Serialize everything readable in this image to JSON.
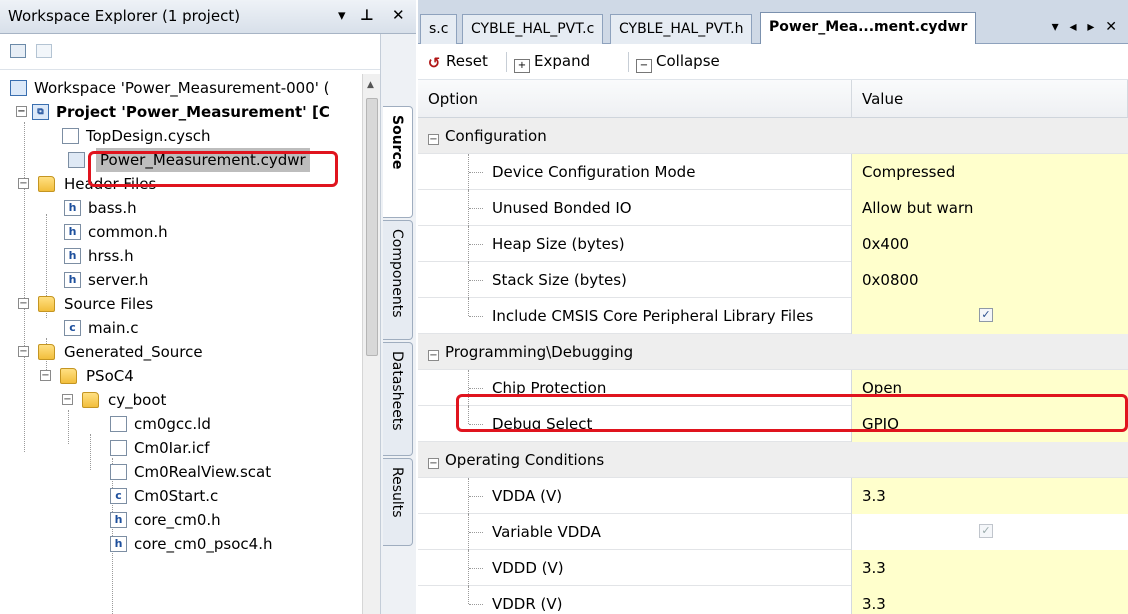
{
  "explorer": {
    "title": "Workspace Explorer (1 project)",
    "controls": "▾ ⊥ ✕",
    "tree": {
      "workspace": "Workspace 'Power_Measurement-000' (",
      "project": "Project  'Power_Measurement' [C",
      "items": [
        {
          "label": "TopDesign.cysch"
        },
        {
          "label": "Power_Measurement.cydwr"
        },
        {
          "label": "Header Files"
        },
        {
          "label": "bass.h"
        },
        {
          "label": "common.h"
        },
        {
          "label": "hrss.h"
        },
        {
          "label": "server.h"
        },
        {
          "label": "Source Files"
        },
        {
          "label": "main.c"
        },
        {
          "label": "Generated_Source"
        },
        {
          "label": "PSoC4"
        },
        {
          "label": "cy_boot"
        },
        {
          "label": "cm0gcc.ld"
        },
        {
          "label": "Cm0Iar.icf"
        },
        {
          "label": "Cm0RealView.scat"
        },
        {
          "label": "Cm0Start.c"
        },
        {
          "label": "core_cm0.h"
        },
        {
          "label": "core_cm0_psoc4.h"
        }
      ]
    },
    "side_tabs": [
      "Source",
      "Components",
      "Datasheets",
      "Results"
    ]
  },
  "editor": {
    "tabs": [
      "s.c",
      "CYBLE_HAL_PVT.c",
      "CYBLE_HAL_PVT.h",
      "Power_Mea...ment.cydwr"
    ],
    "tab_controls": "▾ ◂ ▸ ✕",
    "commands": {
      "reset": "Reset",
      "expand": "Expand",
      "collapse": "Collapse"
    },
    "grid": {
      "headers": [
        "Option",
        "Value"
      ],
      "rows": [
        {
          "type": "cat",
          "label": "Configuration"
        },
        {
          "type": "opt",
          "label": "Device Configuration Mode",
          "value": "Compressed"
        },
        {
          "type": "opt",
          "label": "Unused Bonded IO",
          "value": "Allow but warn"
        },
        {
          "type": "opt",
          "label": "Heap Size (bytes)",
          "value": "0x400"
        },
        {
          "type": "opt",
          "label": "Stack Size (bytes)",
          "value": "0x0800"
        },
        {
          "type": "chk",
          "label": "Include CMSIS Core Peripheral Library Files",
          "checked": true
        },
        {
          "type": "cat",
          "label": "Programming\\Debugging"
        },
        {
          "type": "opt",
          "label": "Chip Protection",
          "value": "Open"
        },
        {
          "type": "opt",
          "label": "Debug Select",
          "value": "GPIO"
        },
        {
          "type": "cat",
          "label": "Operating Conditions"
        },
        {
          "type": "opt",
          "label": "VDDA (V)",
          "value": "3.3"
        },
        {
          "type": "chkdim",
          "label": "Variable VDDA",
          "checked": true
        },
        {
          "type": "opt",
          "label": "VDDD (V)",
          "value": "3.3"
        },
        {
          "type": "opt",
          "label": "VDDR (V)",
          "value": "3.3"
        }
      ]
    }
  },
  "colors": {
    "highlight": "#e0141e",
    "value_bg": "#ffffcc",
    "category_bg": "#eeeeee"
  }
}
